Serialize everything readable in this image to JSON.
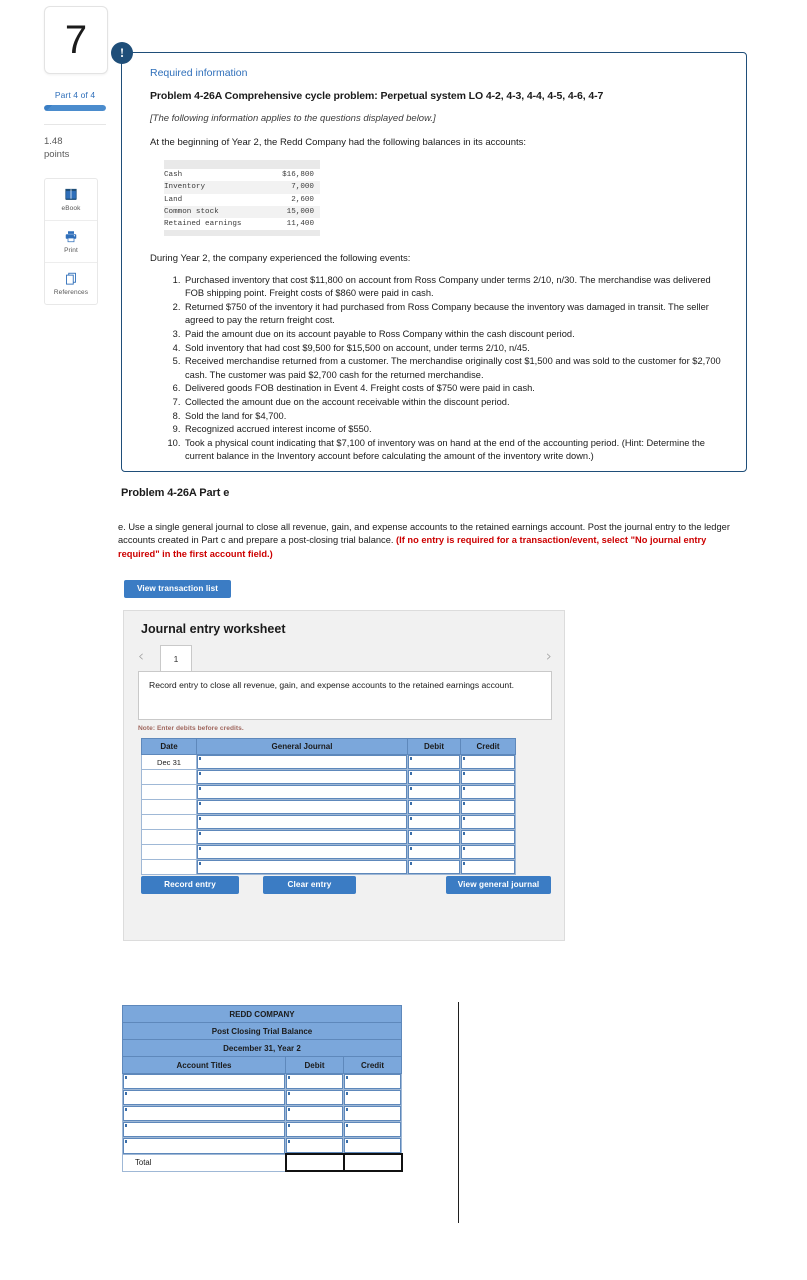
{
  "rail": {
    "question_number": "7",
    "part_label": "Part 4 of 4",
    "points_value": "1.48",
    "points_unit": "points",
    "tools": [
      {
        "name": "ebook",
        "label": "eBook"
      },
      {
        "name": "print",
        "label": "Print"
      },
      {
        "name": "references",
        "label": "References"
      }
    ]
  },
  "required_info": {
    "badge": "!",
    "heading": "Required information",
    "problem_title": "Problem 4-26A Comprehensive cycle problem: Perpetual system LO 4-2, 4-3, 4-4, 4-5, 4-6, 4-7",
    "applies_note": "[The following information applies to the questions displayed below.]",
    "lead_in": "At the beginning of Year 2, the Redd Company had the following balances in its accounts:",
    "balances": [
      {
        "account": "Cash",
        "amount": "$16,800"
      },
      {
        "account": "Inventory",
        "amount": "7,000"
      },
      {
        "account": "Land",
        "amount": "2,600"
      },
      {
        "account": "Common stock",
        "amount": "15,000"
      },
      {
        "account": "Retained earnings",
        "amount": "11,400"
      }
    ],
    "events_lead": "During Year 2, the company experienced the following events:",
    "events": [
      "Purchased inventory that cost $11,800 on account from Ross Company under terms 2/10, n/30. The merchandise was delivered FOB shipping point. Freight costs of $860 were paid in cash.",
      "Returned $750 of the inventory it had purchased from Ross Company because the inventory was damaged in transit. The seller agreed to pay the return freight cost.",
      "Paid the amount due on its account payable to Ross Company within the cash discount period.",
      "Sold inventory that had cost $9,500 for $15,500 on account, under terms 2/10, n/45.",
      "Received merchandise returned from a customer. The merchandise originally cost $1,500 and was sold to the customer for $2,700 cash. The customer was paid $2,700 cash for the returned merchandise.",
      "Delivered goods FOB destination in Event 4. Freight costs of $750 were paid in cash.",
      "Collected the amount due on the account receivable within the discount period.",
      "Sold the land for $4,700.",
      "Recognized accrued interest income of $550.",
      "Took a physical count indicating that $7,100 of inventory was on hand at the end of the accounting period. (Hint: Determine the current balance in the Inventory account before calculating the amount of the inventory write down.)"
    ]
  },
  "part_e": {
    "heading": "Problem 4-26A Part e",
    "instruction_black": "e. Use a single general journal to close all revenue, gain, and expense accounts to the retained earnings account. Post the journal entry to the ledger accounts created in Part c and prepare a post-closing trial balance.",
    "instruction_red": "(If no entry is required for a transaction/event, select \"No journal entry required\" in the first account field.)",
    "view_transaction_list": "View transaction list"
  },
  "worksheet": {
    "title": "Journal entry worksheet",
    "prev_icon": "chevron-left-icon",
    "next_icon": "chevron-right-icon",
    "active_tab": "1",
    "description": "Record entry to close all revenue, gain, and expense accounts to the retained earnings account.",
    "note": "Note: Enter debits before credits.",
    "columns": [
      "Date",
      "General Journal",
      "Debit",
      "Credit"
    ],
    "rows": [
      {
        "date": "Dec 31",
        "journal": "",
        "debit": "",
        "credit": ""
      },
      {
        "date": "",
        "journal": "",
        "debit": "",
        "credit": ""
      },
      {
        "date": "",
        "journal": "",
        "debit": "",
        "credit": ""
      },
      {
        "date": "",
        "journal": "",
        "debit": "",
        "credit": ""
      },
      {
        "date": "",
        "journal": "",
        "debit": "",
        "credit": ""
      },
      {
        "date": "",
        "journal": "",
        "debit": "",
        "credit": ""
      },
      {
        "date": "",
        "journal": "",
        "debit": "",
        "credit": ""
      },
      {
        "date": "",
        "journal": "",
        "debit": "",
        "credit": ""
      }
    ],
    "buttons": {
      "record": "Record entry",
      "clear": "Clear entry",
      "view_journal": "View general journal"
    }
  },
  "trial_balance": {
    "company": "REDD COMPANY",
    "statement": "Post Closing Trial Balance",
    "date": "December 31, Year 2",
    "columns": [
      "Account Titles",
      "Debit",
      "Credit"
    ],
    "rows": [
      {
        "title": "",
        "debit": "",
        "credit": ""
      },
      {
        "title": "",
        "debit": "",
        "credit": ""
      },
      {
        "title": "",
        "debit": "",
        "credit": ""
      },
      {
        "title": "",
        "debit": "",
        "credit": ""
      },
      {
        "title": "",
        "debit": "",
        "credit": ""
      }
    ],
    "total_label": "Total"
  },
  "colors": {
    "accent_blue": "#3b7cc4",
    "panel_border": "#1f4e79",
    "table_header": "#7ba7db",
    "red_text": "#cc0000",
    "link_blue": "#2f6fba"
  }
}
